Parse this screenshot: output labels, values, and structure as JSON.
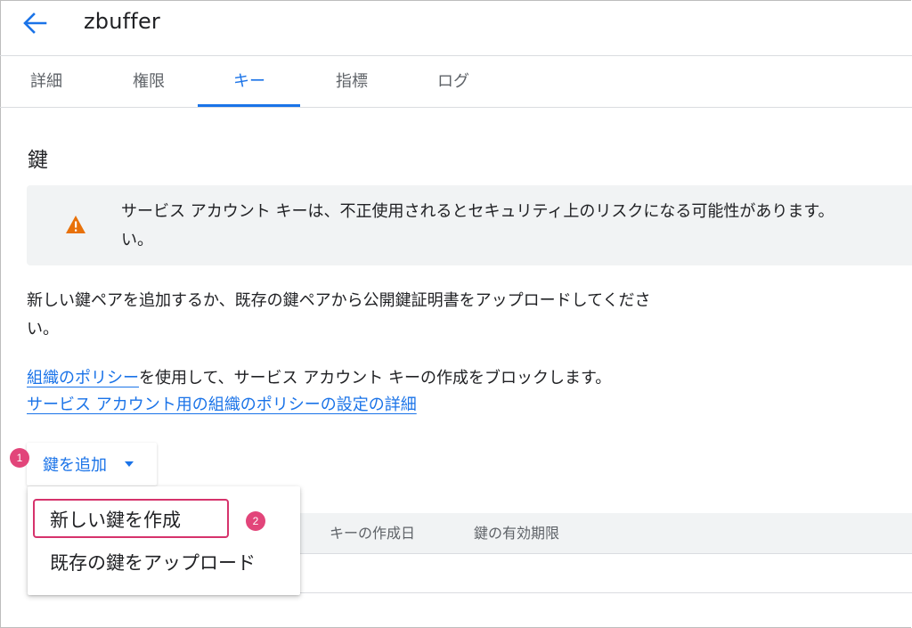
{
  "header": {
    "title": "zbuffer",
    "back_icon": "arrow-left-icon"
  },
  "tabs": [
    {
      "label": "詳細"
    },
    {
      "label": "権限"
    },
    {
      "label": "キー"
    },
    {
      "label": "指標"
    },
    {
      "label": "ログ"
    }
  ],
  "active_tab": "キー",
  "section": {
    "title": "鍵"
  },
  "warning": {
    "icon": "warning-icon",
    "text": "サービス アカウント キーは、不正使用されるとセキュリティ上のリスクになる可能性があります。\nい。"
  },
  "description": "新しい鍵ペアを追加するか、既存の鍵ペアから公開鍵証明書をアップロードしてくださ\nい。",
  "policy": {
    "link1": "組織のポリシー",
    "text": "を使用して、サービス アカウント キーの作成をブロックします。",
    "link2": "サービス アカウント用の組織のポリシーの設定の詳細"
  },
  "add_key": {
    "label": "鍵を追加",
    "caret_icon": "caret-down-icon"
  },
  "dropdown": {
    "items": [
      {
        "label": "新しい鍵を作成"
      },
      {
        "label": "既存の鍵をアップロード"
      }
    ]
  },
  "table": {
    "headers": [
      "キーの作成日",
      "鍵の有効期限"
    ]
  },
  "badges": {
    "step1": "1",
    "step2": "2"
  },
  "colors": {
    "accent": "#1a73e8",
    "warning": "#e8710a",
    "annotation": "#e2457a"
  }
}
